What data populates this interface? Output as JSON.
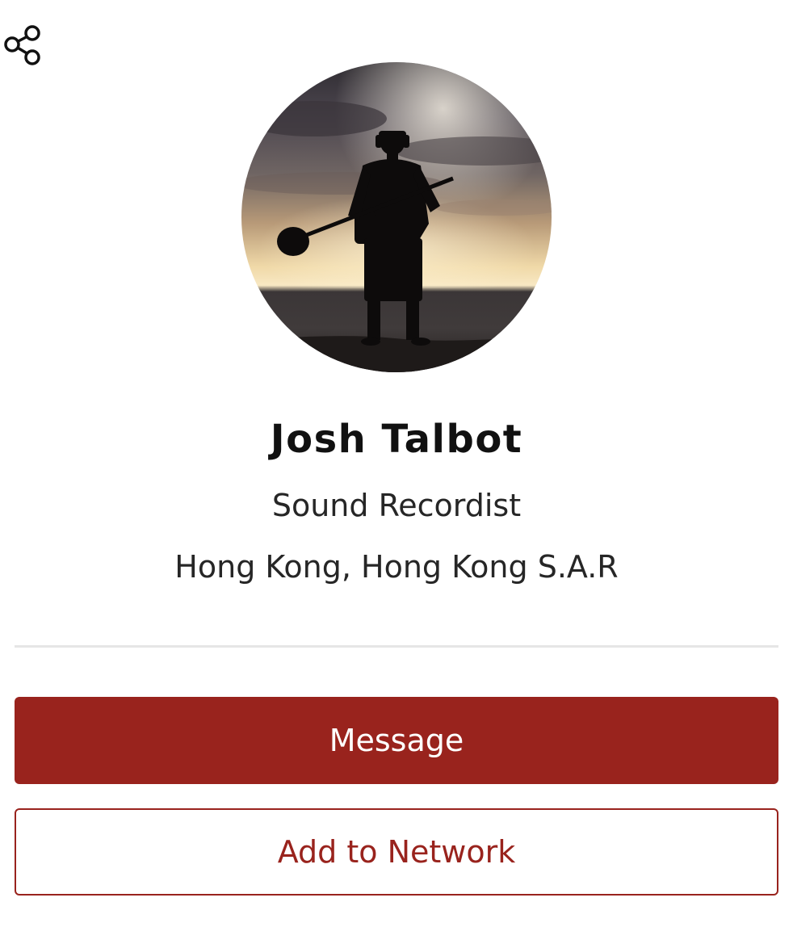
{
  "header": {
    "share_icon": "share-icon"
  },
  "profile": {
    "avatar_icon": "profile-photo",
    "name": "Josh Talbot",
    "role": "Sound Recordist",
    "location": "Hong Kong, Hong Kong S.A.R"
  },
  "actions": {
    "message_label": "Message",
    "add_network_label": "Add to Network"
  },
  "colors": {
    "accent": "#99231d",
    "divider": "#e6e6e6",
    "text_primary": "#111111",
    "text_secondary": "#262626"
  }
}
